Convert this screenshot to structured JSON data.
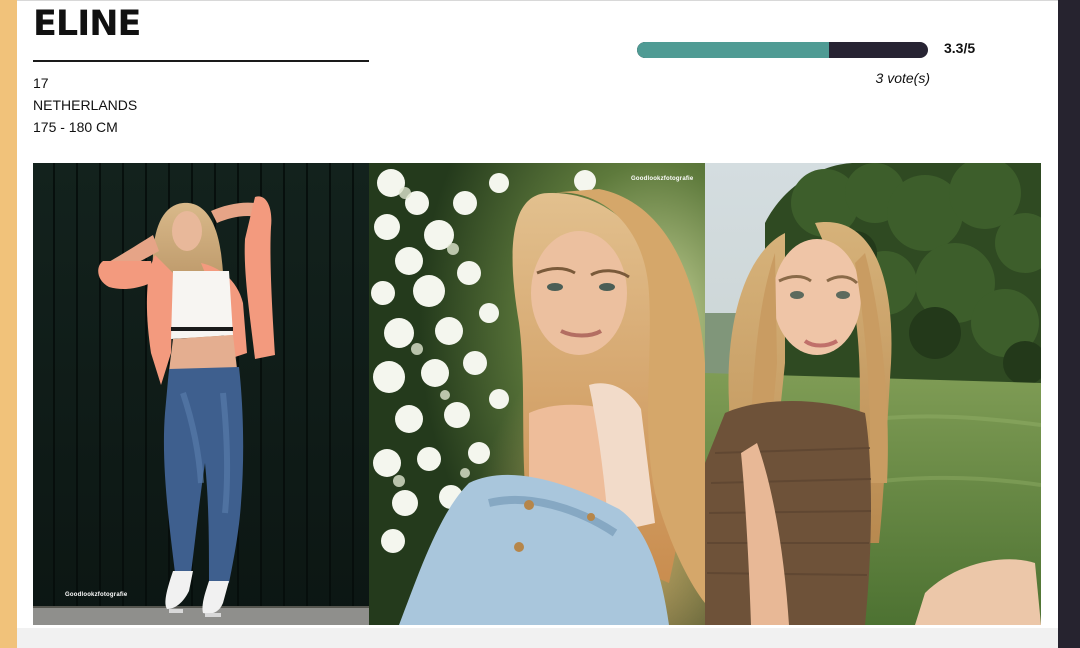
{
  "profile": {
    "name": "ELINE",
    "age": "17",
    "country": "NETHERLANDS",
    "height": "175 - 180 CM"
  },
  "rating": {
    "value": 3.3,
    "max": 5,
    "fraction": 0.66,
    "score_text": "3.3/5",
    "votes_text": "3 vote(s)",
    "fill_color": "#4f9b94",
    "track_color": "#272433"
  },
  "photos": [
    {
      "watermark": "Goodlookzfotografie"
    },
    {
      "watermark": "Goodlookzfotografie"
    },
    {
      "watermark": ""
    }
  ],
  "colors": {
    "left_strip": "#f1c27a",
    "right_strip": "#26232f"
  }
}
